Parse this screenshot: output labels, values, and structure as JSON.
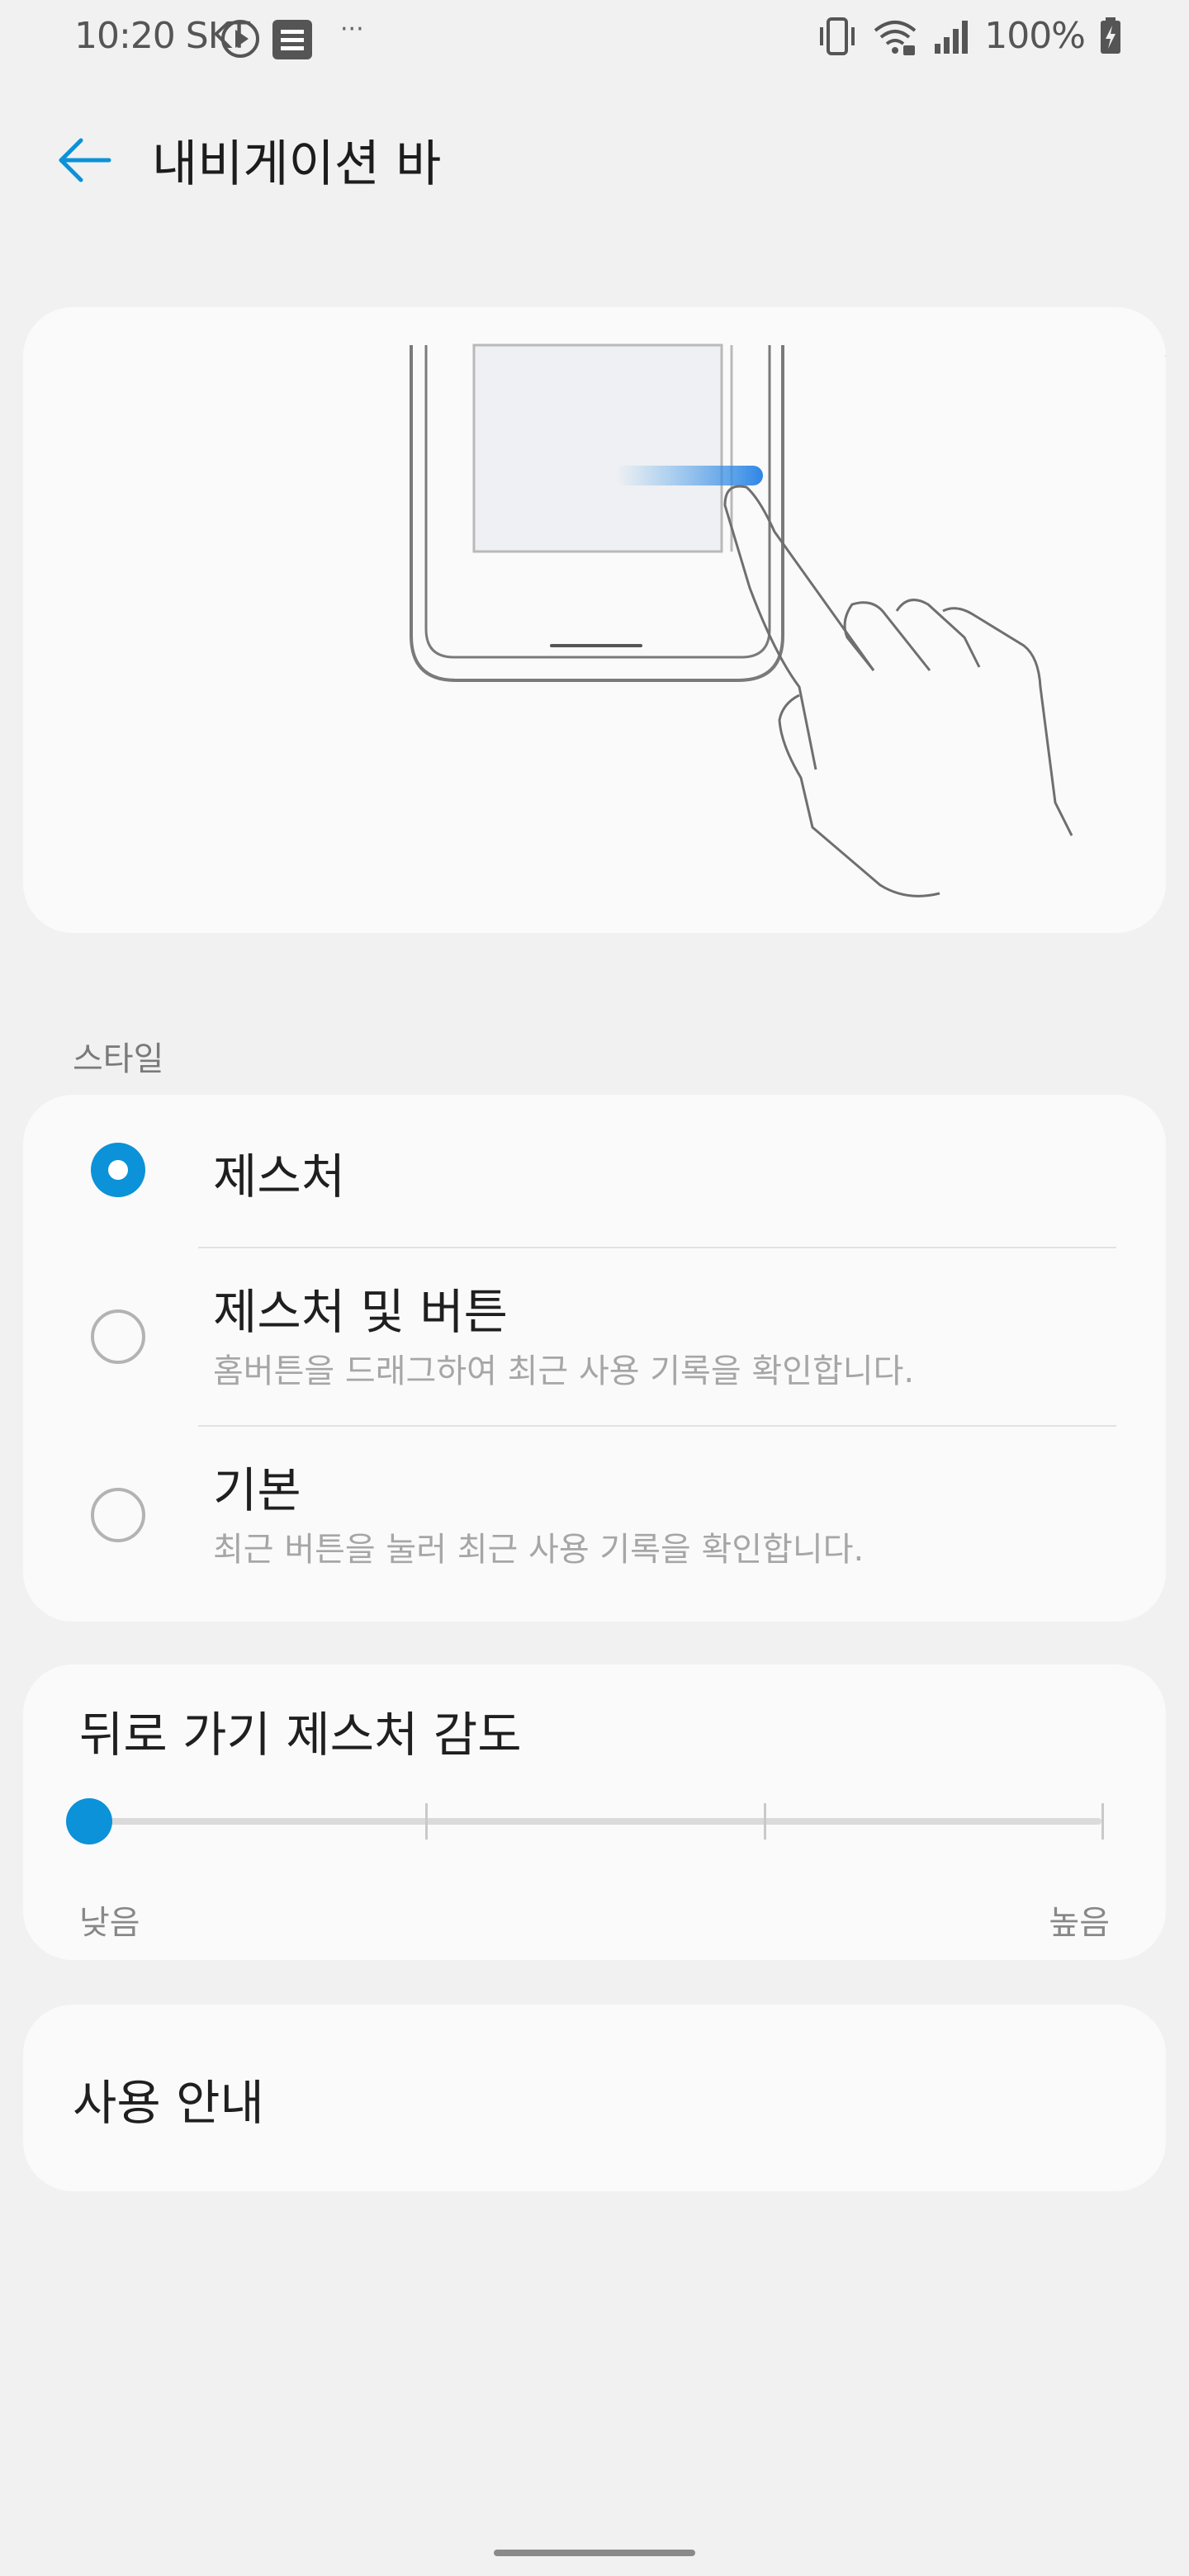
{
  "status_bar": {
    "time": "10:20 SKT",
    "more": "···",
    "battery": "100%"
  },
  "header": {
    "title": "내비게이션 바"
  },
  "style_section": {
    "label": "스타일",
    "options": [
      {
        "title": "제스처",
        "desc": "",
        "selected": true
      },
      {
        "title": "제스처 및 버튼",
        "desc": "홈버튼을 드래그하여 최근 사용 기록을 확인합니다.",
        "selected": false
      },
      {
        "title": "기본",
        "desc": "최근 버튼을 눌러 최근 사용 기록을 확인합니다.",
        "selected": false
      }
    ]
  },
  "sensitivity": {
    "title": "뒤로 가기 제스처 감도",
    "min_label": "낮음",
    "max_label": "높음",
    "level": 0,
    "steps": 4
  },
  "guide": {
    "label": "사용 안내"
  },
  "colors": {
    "accent": "#0b92d8",
    "background": "#f1f1f1",
    "card": "#fafafa"
  }
}
